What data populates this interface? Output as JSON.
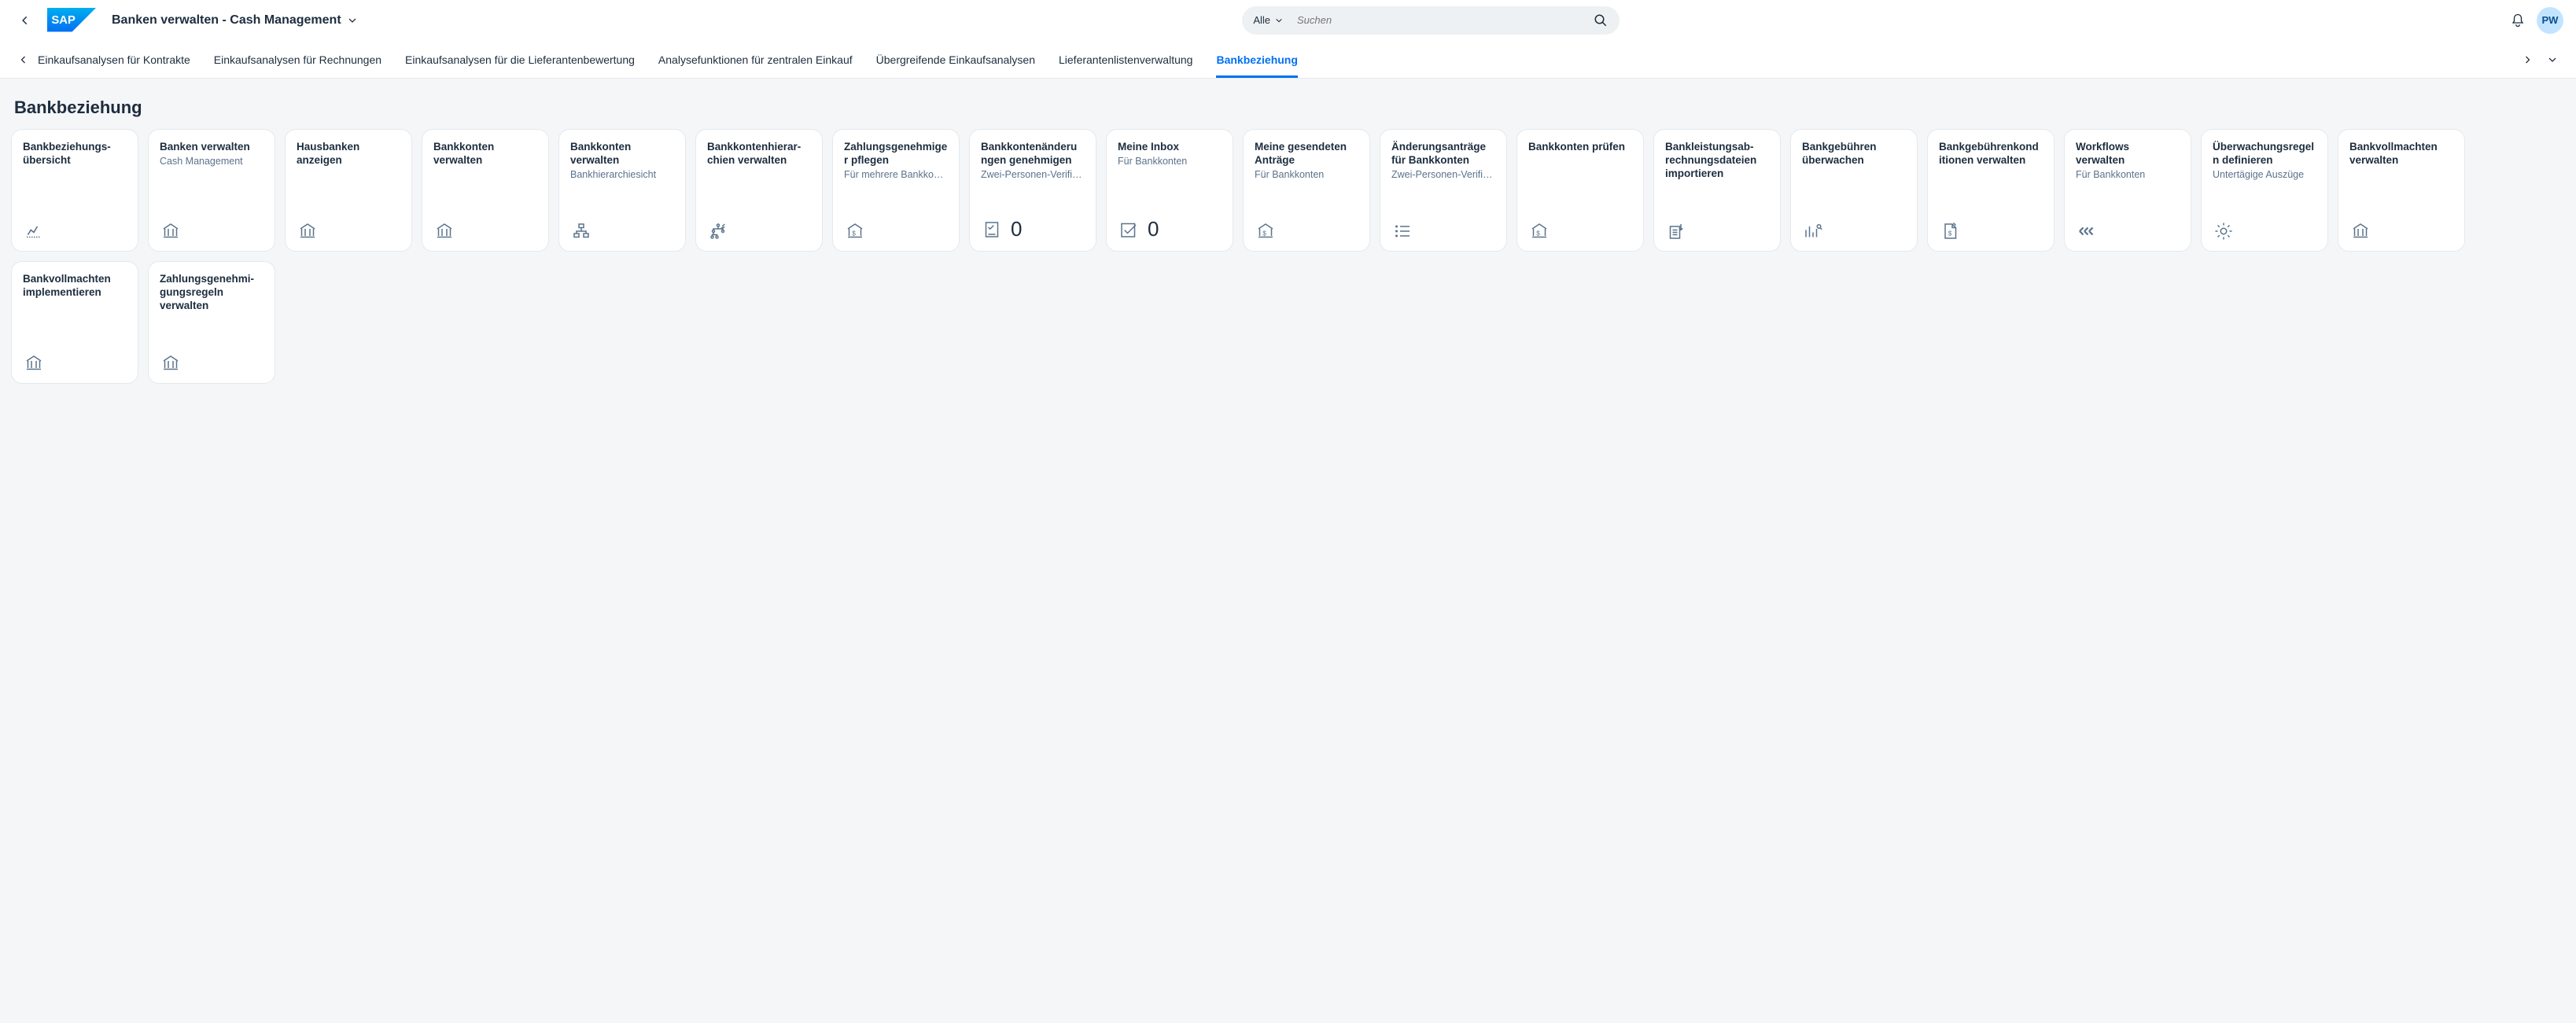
{
  "header": {
    "title": "Banken verwalten - Cash Management",
    "search_filter": "Alle",
    "search_placeholder": "Suchen",
    "avatar": "PW"
  },
  "tabs": [
    {
      "label": "Einkaufsanalysen für Kontrakte",
      "active": false
    },
    {
      "label": "Einkaufsanalysen für Rechnungen",
      "active": false
    },
    {
      "label": "Einkaufsanalysen für die Lieferantenbewertung",
      "active": false
    },
    {
      "label": "Analysefunktionen für zentralen Einkauf",
      "active": false
    },
    {
      "label": "Übergreifende Einkaufsanalysen",
      "active": false
    },
    {
      "label": "Lieferantenlistenverwaltung",
      "active": false
    },
    {
      "label": "Bankbeziehung",
      "active": true
    }
  ],
  "page": {
    "title": "Bankbeziehung"
  },
  "tiles": [
    {
      "title": "Bankbeziehungs­übersicht",
      "sub": "",
      "icon": "chart",
      "count": null
    },
    {
      "title": "Banken verwalten",
      "sub": "Cash Management",
      "icon": "bank",
      "count": null
    },
    {
      "title": "Hausbanken anzeigen",
      "sub": "",
      "icon": "bank",
      "count": null
    },
    {
      "title": "Bankkonten verwalten",
      "sub": "",
      "icon": "bank",
      "count": null
    },
    {
      "title": "Bankkonten verwalten",
      "sub": "Bankhierarchiesicht",
      "icon": "hierarchy",
      "count": null
    },
    {
      "title": "Bankkontenhierar­chien verwalten",
      "sub": "",
      "icon": "hierarchy2",
      "count": null
    },
    {
      "title": "Zahlungsgenehmiger pflegen",
      "sub": "Für mehrere Bankko…",
      "icon": "bank-dollar",
      "count": null
    },
    {
      "title": "Bankkontenänderun­gen genehmigen",
      "sub": "Zwei-Personen-Verifi…",
      "icon": "checklist",
      "count": "0"
    },
    {
      "title": "Meine Inbox",
      "sub": "Für Bankkonten",
      "icon": "checkbox",
      "count": "0"
    },
    {
      "title": "Meine gesendeten Anträge",
      "sub": "Für Bankkonten",
      "icon": "bank-dollar",
      "count": null
    },
    {
      "title": "Änderungsanträge für Bankkonten",
      "sub": "Zwei-Personen-Verifi…",
      "icon": "list",
      "count": null
    },
    {
      "title": "Bankkonten prüfen",
      "sub": "",
      "icon": "bank-dollar",
      "count": null
    },
    {
      "title": "Bankleistungsab­rechnungsdateien importieren",
      "sub": "",
      "icon": "import",
      "count": null
    },
    {
      "title": "Bankgebühren überwachen",
      "sub": "",
      "icon": "barchart",
      "count": null
    },
    {
      "title": "Bankgebührenkondi­tionen verwalten",
      "sub": "",
      "icon": "document-dollar",
      "count": null
    },
    {
      "title": "Workflows verwalten",
      "sub": "Für Bankkonten",
      "icon": "workflow",
      "count": null
    },
    {
      "title": "Überwachungsregeln definieren",
      "sub": "Untertägige Auszüge",
      "icon": "gear",
      "count": null
    },
    {
      "title": "Bankvollmachten verwalten",
      "sub": "",
      "icon": "bank",
      "count": null
    },
    {
      "title": "Bankvollmachten implementieren",
      "sub": "",
      "icon": "bank",
      "count": null
    },
    {
      "title": "Zahlungsgenehmi­gungsregeln verwalten",
      "sub": "",
      "icon": "bank",
      "count": null
    }
  ]
}
